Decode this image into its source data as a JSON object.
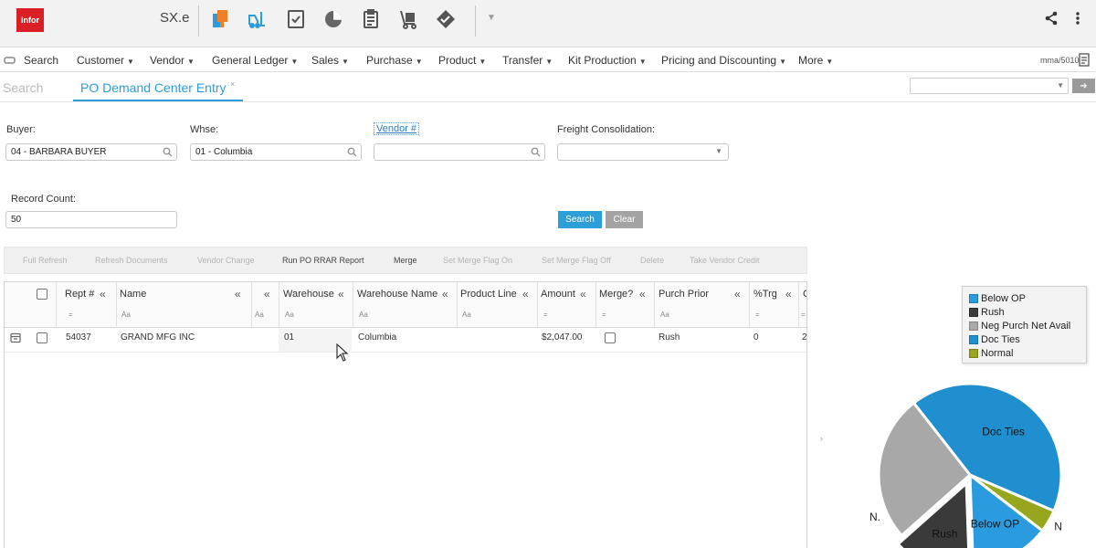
{
  "app": {
    "product_name": "SX.e",
    "logo_text": "infor",
    "colors": {
      "brand_red": "#da1f26",
      "accent_blue": "#2d9cdb",
      "orange": "#f07e26"
    },
    "toolbar_icons": [
      "bookmark-stack-icon",
      "forklift-icon",
      "checklist-icon",
      "pie-chart-icon",
      "clipboard-icon",
      "hand-truck-icon",
      "handshake-icon"
    ]
  },
  "menu": {
    "items": [
      "Search",
      "Customer",
      "Vendor",
      "General Ledger",
      "Sales",
      "Purchase",
      "Product",
      "Transfer",
      "Kit Production",
      "Pricing and Discounting",
      "More"
    ],
    "user_id": "mma/5010"
  },
  "tabs": {
    "search_label": "Search",
    "active_label": "PO Demand Center Entry",
    "close_glyph": "×"
  },
  "form": {
    "buyer_label": "Buyer:",
    "buyer_value": "04 - BARBARA BUYER",
    "whse_label": "Whse:",
    "whse_value": "01 - Columbia",
    "vendor_label": "Vendor #",
    "vendor_value": "",
    "freight_label": "Freight Consolidation:",
    "freight_value": "",
    "record_count_label": "Record Count:",
    "record_count_value": "50",
    "search_button": "Search",
    "clear_button": "Clear"
  },
  "actions": [
    {
      "label": "Full Refresh",
      "enabled": false
    },
    {
      "label": "Refresh Documents",
      "enabled": false
    },
    {
      "label": "Vendor Change",
      "enabled": false
    },
    {
      "label": "Run PO RRAR Report",
      "enabled": true
    },
    {
      "label": "Merge",
      "enabled": true
    },
    {
      "label": "Set Merge Flag On",
      "enabled": false
    },
    {
      "label": "Set Merge Flag Off",
      "enabled": false
    },
    {
      "label": "Delete",
      "enabled": false
    },
    {
      "label": "Take Vendor Credit",
      "enabled": false
    }
  ],
  "grid": {
    "columns": [
      "Rept #",
      "Name",
      "Warehouse",
      "Warehouse Name",
      "Product Line",
      "Amount",
      "Merge?",
      "Purch Prior",
      "%Trg",
      "C"
    ],
    "filter_glyphs": {
      "equals": "=",
      "text": "Aa"
    },
    "collapse_glyph": "«",
    "rows": [
      {
        "rept": "54037",
        "name": "GRAND MFG INC",
        "warehouse": "01",
        "warehouse_name": "Columbia",
        "product_line": "",
        "amount": "$2,047.00",
        "purch_prior": "Rush",
        "trg": "0",
        "c": "2"
      }
    ]
  },
  "chart_data": {
    "type": "pie",
    "legend_placement": "top-right",
    "legend": [
      "Below OP",
      "Rush",
      "Neg Purch Net Avail",
      "Doc Ties",
      "Normal"
    ],
    "slices": [
      {
        "name": "Doc Ties",
        "label": "Doc Ties",
        "value": 42,
        "color": "#1f8fd0"
      },
      {
        "name": "Normal",
        "label": "N",
        "value": 4,
        "color": "#98a61d"
      },
      {
        "name": "Below OP",
        "label": "Below OP",
        "value": 14,
        "color": "#2b9be0"
      },
      {
        "name": "Rush",
        "label": "Rush",
        "value": 14,
        "color": "#3a3a3a"
      },
      {
        "name": "Neg Purch Net Avail",
        "label": "N.",
        "value": 26,
        "color": "#a8a8a8"
      }
    ],
    "legend_colors": [
      "#2b9be0",
      "#3a3a3a",
      "#a8a8a8",
      "#1f8fd0",
      "#98a61d"
    ]
  }
}
